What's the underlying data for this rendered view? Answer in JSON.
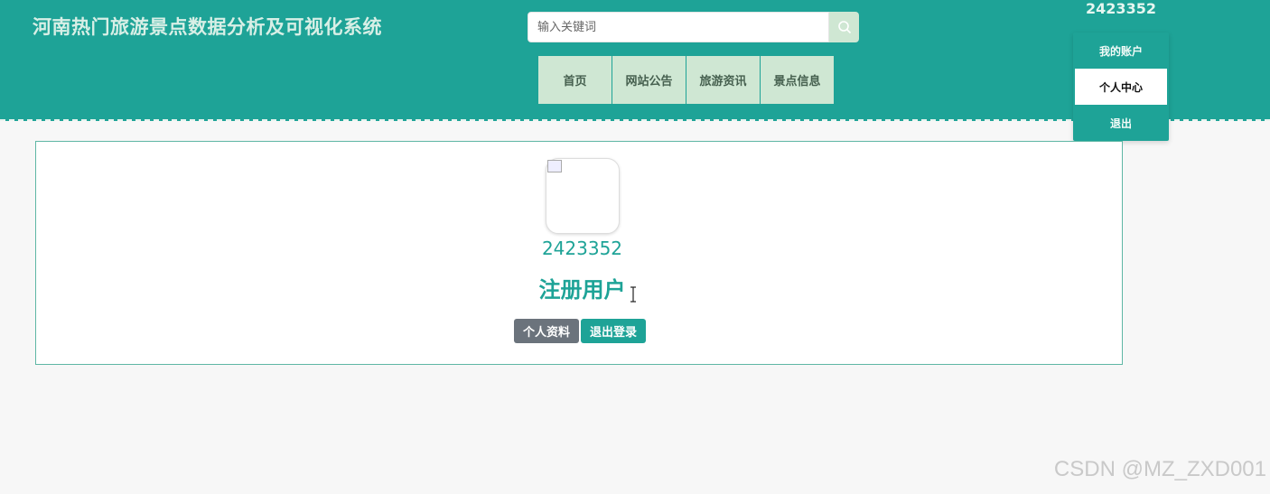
{
  "header": {
    "site_title": "河南热门旅游景点数据分析及可视化系统",
    "search_placeholder": "输入关键词",
    "nav": [
      "首页",
      "网站公告",
      "旅游资讯",
      "景点信息"
    ],
    "username": "2423352"
  },
  "account_menu": {
    "title": "我的账户",
    "items": [
      "个人中心",
      "退出"
    ],
    "active_index": 0
  },
  "profile": {
    "avatar_icon": "broken-image-icon",
    "username": "2423352",
    "role": "注册用户",
    "buttons": {
      "profile_label": "个人资料",
      "logout_label": "退出登录"
    }
  },
  "watermark": "CSDN @MZ_ZXD001",
  "colors": {
    "primary": "#1ea397",
    "nav_bg": "#cfe7d3",
    "button_gray": "#6b737c"
  }
}
